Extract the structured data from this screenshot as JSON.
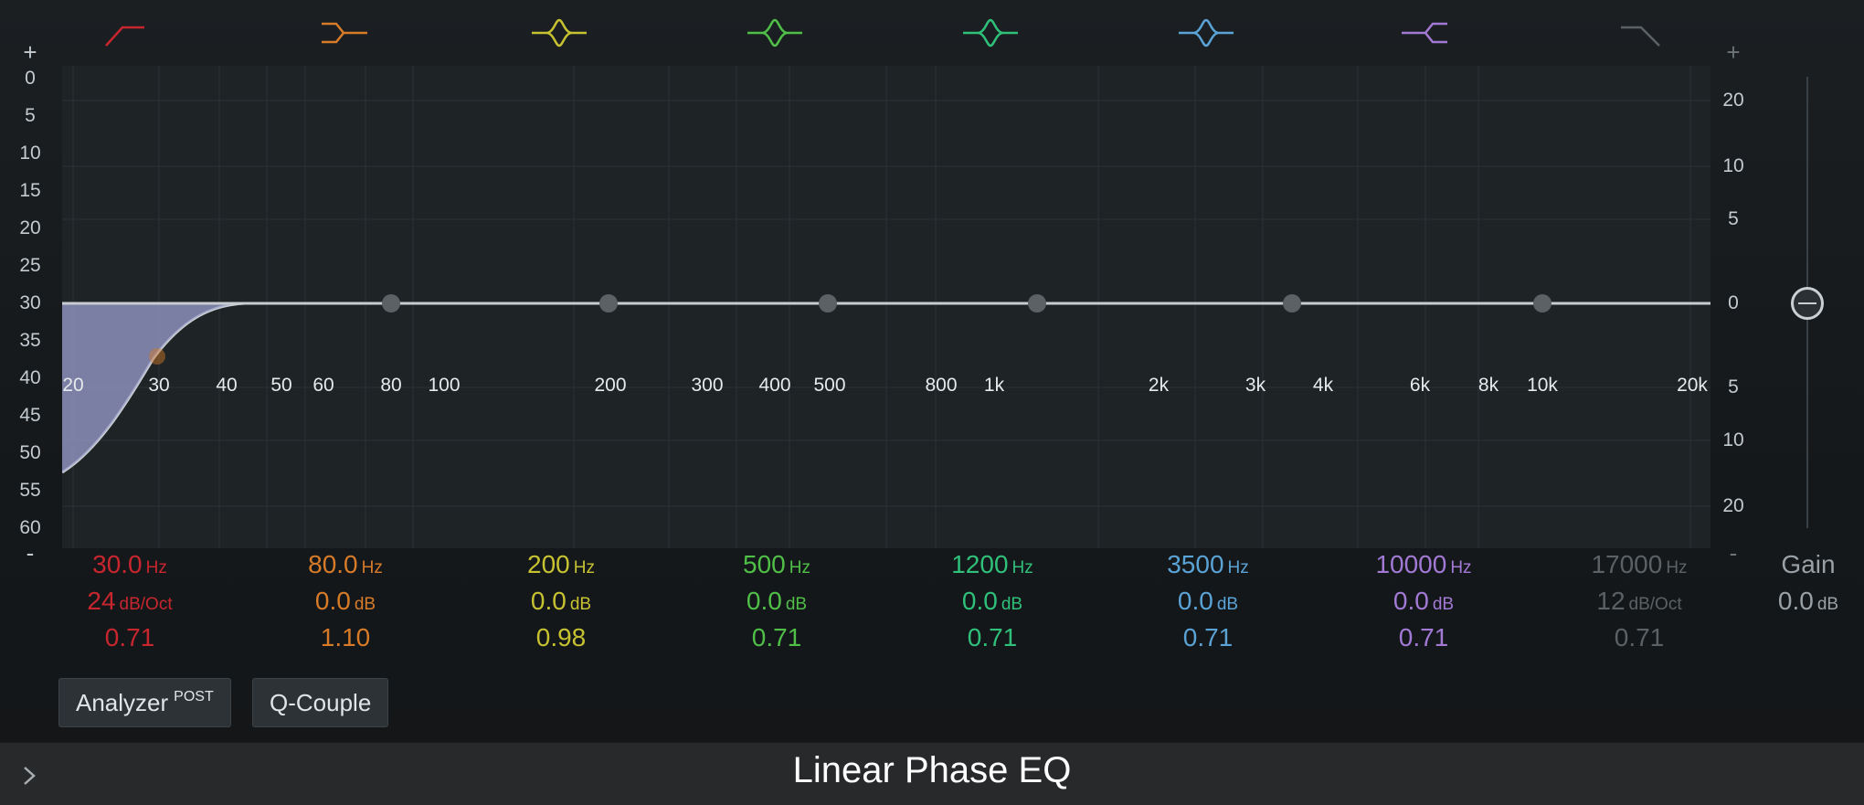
{
  "plugin_title": "Linear Phase EQ",
  "left_scale": {
    "plus": "+",
    "minus": "-",
    "values": [
      "0",
      "5",
      "10",
      "15",
      "20",
      "25",
      "30",
      "35",
      "40",
      "45",
      "50",
      "55",
      "60"
    ]
  },
  "right_scale": {
    "plus": "+",
    "minus": "-",
    "values": [
      "20",
      "10",
      "5",
      "0",
      "5",
      "10",
      "20"
    ]
  },
  "freq_labels": [
    "20",
    "30",
    "40",
    "50",
    "60",
    "80",
    "100",
    "200",
    "300",
    "400",
    "500",
    "800",
    "1k",
    "2k",
    "3k",
    "4k",
    "6k",
    "8k",
    "10k",
    "20k"
  ],
  "bands": [
    {
      "icon": "low-cut-icon",
      "color": "#c8262e",
      "freq": "30.0",
      "freq_unit": "Hz",
      "second": "24",
      "second_unit": "dB/Oct",
      "q": "0.71"
    },
    {
      "icon": "low-shelf-icon",
      "color": "#d77b29",
      "freq": "80.0",
      "freq_unit": "Hz",
      "second": "0.0",
      "second_unit": "dB",
      "q": "1.10"
    },
    {
      "icon": "bell-icon",
      "color": "#c6c231",
      "freq": "200",
      "freq_unit": "Hz",
      "second": "0.0",
      "second_unit": "dB",
      "q": "0.98"
    },
    {
      "icon": "bell-icon",
      "color": "#4fbf48",
      "freq": "500",
      "freq_unit": "Hz",
      "second": "0.0",
      "second_unit": "dB",
      "q": "0.71"
    },
    {
      "icon": "bell-icon",
      "color": "#2fc07a",
      "freq": "1200",
      "freq_unit": "Hz",
      "second": "0.0",
      "second_unit": "dB",
      "q": "0.71"
    },
    {
      "icon": "bell-icon",
      "color": "#5aa3d6",
      "freq": "3500",
      "freq_unit": "Hz",
      "second": "0.0",
      "second_unit": "dB",
      "q": "0.71"
    },
    {
      "icon": "high-shelf-icon",
      "color": "#a27ad6",
      "freq": "10000",
      "freq_unit": "Hz",
      "second": "0.0",
      "second_unit": "dB",
      "q": "0.71"
    },
    {
      "icon": "high-cut-icon",
      "color": "#5b6164",
      "freq": "17000",
      "freq_unit": "Hz",
      "second": "12",
      "second_unit": "dB/Oct",
      "q": "0.71"
    }
  ],
  "gain": {
    "label": "Gain",
    "value": "0.0",
    "unit": "dB"
  },
  "buttons": {
    "analyzer": "Analyzer",
    "analyzer_mode": "POST",
    "q_couple": "Q-Couple"
  }
}
